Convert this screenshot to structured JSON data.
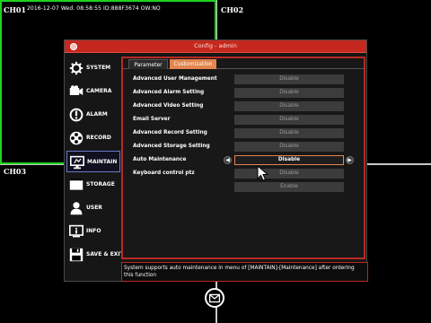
{
  "osd": {
    "channels": [
      "CH01",
      "CH02",
      "CH03"
    ],
    "info": "2016-12-07 Wed. 08:58:55 ID:888F3674 OW:NO"
  },
  "dialog": {
    "title": "Config - admin"
  },
  "sidebar": {
    "items": [
      {
        "label": "SYSTEM",
        "icon": "gear-icon"
      },
      {
        "label": "CAMERA",
        "icon": "camera-icon"
      },
      {
        "label": "ALARM",
        "icon": "alarm-icon"
      },
      {
        "label": "RECORD",
        "icon": "record-icon"
      },
      {
        "label": "MAINTAIN",
        "icon": "monitor-icon",
        "active": true
      },
      {
        "label": "STORAGE",
        "icon": "storage-icon"
      },
      {
        "label": "USER",
        "icon": "user-icon"
      },
      {
        "label": "INFO",
        "icon": "info-icon"
      },
      {
        "label": "SAVE & EXIT",
        "icon": "save-icon"
      }
    ]
  },
  "tabs": [
    {
      "label": "Parameter"
    },
    {
      "label": "Customization",
      "active": true
    }
  ],
  "settings": [
    {
      "label": "Advanced User Management",
      "value": "Disable"
    },
    {
      "label": "Advanced Alarm Setting",
      "value": "Disable"
    },
    {
      "label": "Advanced Video Setting",
      "value": "Disable"
    },
    {
      "label": "Email Server",
      "value": "Disable"
    },
    {
      "label": "Advanced Record Setting",
      "value": "Disable"
    },
    {
      "label": "Advanced Storage Setting",
      "value": "Disable"
    },
    {
      "label": "Auto Maintenance",
      "value": "Disable",
      "selected": true
    },
    {
      "label": "Keyboard control ptz",
      "value": "Disable"
    },
    {
      "label": "",
      "value": "Enable"
    }
  ],
  "status": {
    "text": "System supports auto maintenance in menu of [MAINTAIN]-[Maintenance] after ordering this function"
  },
  "colors": {
    "accent": "#e2854e",
    "title_bar": "#c4281e",
    "active_channel": "#1fd21f"
  }
}
